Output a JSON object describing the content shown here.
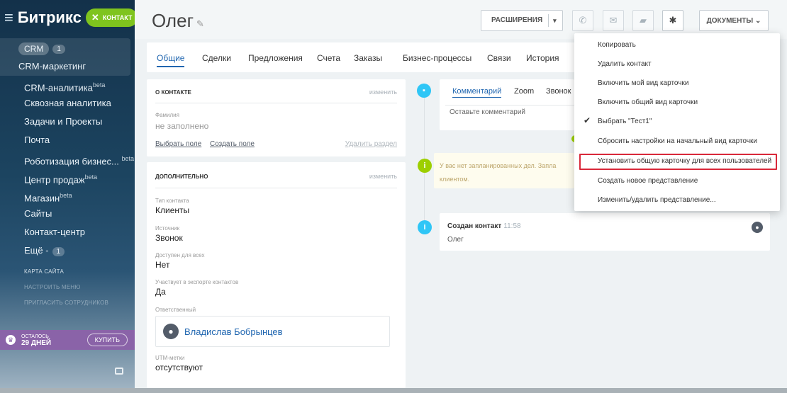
{
  "sidebar": {
    "brand": "Битрикс",
    "contact_pill": "КОНТАКТ",
    "crm_chip": "CRM",
    "crm_count": "1",
    "items": [
      {
        "label": "CRM-маркетинг"
      },
      {
        "label": "CRM-аналитика",
        "sup": "beta"
      },
      {
        "label": "Сквозная аналитика"
      },
      {
        "label": "Задачи и Проекты"
      },
      {
        "label": "Почта"
      },
      {
        "label": "Роботизация бизнес...",
        "sup": "beta"
      },
      {
        "label": "Центр продаж",
        "sup": "beta"
      },
      {
        "label": "Магазин",
        "sup": "beta"
      },
      {
        "label": "Сайты"
      },
      {
        "label": "Контакт-центр"
      }
    ],
    "more_label": "Ещё -",
    "more_count": "1",
    "sitemap": "КАРТА САЙТА",
    "settings_menu": "НАСТРОИТЬ МЕНЮ",
    "invite": "ПРИГЛАСИТЬ СОТРУДНИКОВ",
    "trial_left": "ОСТАЛОСЬ",
    "trial_days": "29 ДНЕЙ",
    "buy": "КУПИТЬ"
  },
  "header": {
    "title": "Олег",
    "extensions": "РАСШИРЕНИЯ",
    "documents": "ДОКУМЕНТЫ"
  },
  "tabs": [
    "Общие",
    "Сделки",
    "Предложения",
    "Счета",
    "Заказы",
    "Бизнес-процессы",
    "Связи",
    "История"
  ],
  "about": {
    "heading": "О КОНТАКТЕ",
    "edit": "изменить",
    "surname_label": "Фамилия",
    "surname_value": "не заполнено",
    "select_field": "Выбрать поле",
    "create_field": "Создать поле",
    "delete_section": "Удалить раздел"
  },
  "extra": {
    "heading": "ДОПОЛНИТЕЛЬНО",
    "edit": "изменить",
    "fields": [
      {
        "label": "Тип контакта",
        "value": "Клиенты"
      },
      {
        "label": "Источник",
        "value": "Звонок"
      },
      {
        "label": "Доступен для всех",
        "value": "Нет"
      },
      {
        "label": "Участвует в экспорте контактов",
        "value": "Да"
      }
    ],
    "responsible_label": "Ответственный",
    "responsible_name": "Владислав Бобрынцев",
    "utm_label": "UTM-метки",
    "utm_value": "отсутствуют"
  },
  "timeline": {
    "tabs": [
      "Комментарий",
      "Zoom",
      "Звонок"
    ],
    "comment_placeholder": "Оставьте комментарий",
    "plan_line1": "У вас нет запланированных дел. Запла",
    "plan_line2": "клиентом.",
    "event_title": "Создан контакт",
    "event_time": "11:58",
    "event_body": "Олег"
  },
  "dropdown": {
    "items": [
      "Копировать",
      "Удалить контакт",
      "Включить мой вид карточки",
      "Включить общий вид карточки",
      "Выбрать \"Тест1\"",
      "Сбросить настройки на начальный вид карточки",
      "Установить общую карточку для всех пользователей",
      "Создать новое представление",
      "Изменить/удалить представление..."
    ]
  }
}
